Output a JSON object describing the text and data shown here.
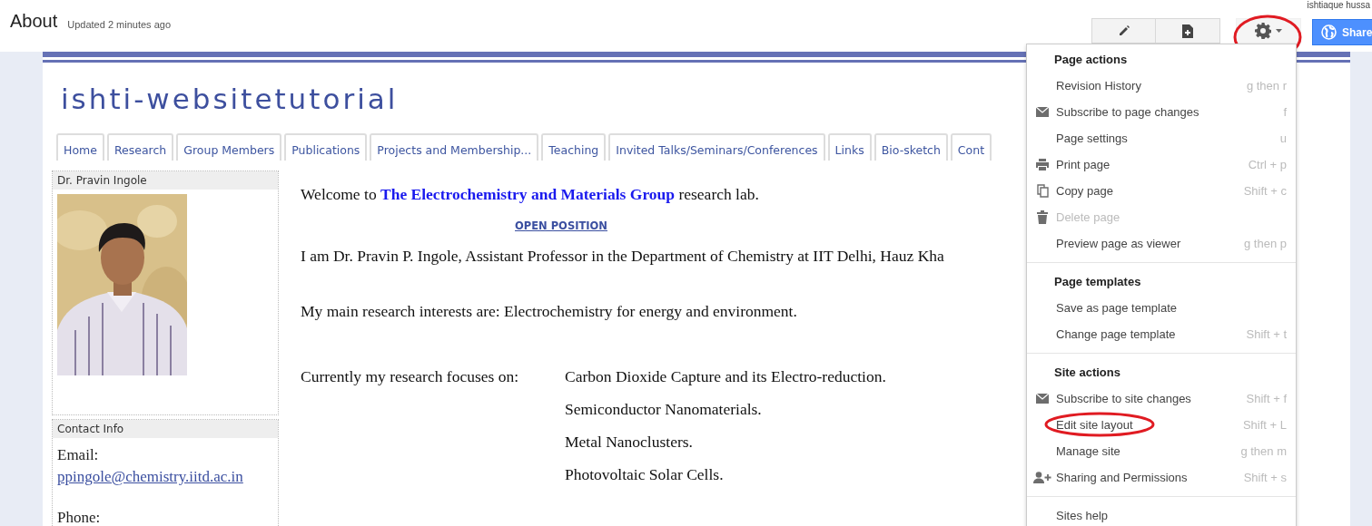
{
  "header": {
    "title": "About",
    "updated": "Updated 2 minutes ago",
    "user": "ishtiaque hussa",
    "share": "Share",
    "settings_circled": true
  },
  "site": {
    "title": "ishti-websitetutorial",
    "tabs": [
      {
        "label": "Home",
        "selected": false
      },
      {
        "label": "Research",
        "selected": false
      },
      {
        "label": "Group Members",
        "selected": false
      },
      {
        "label": "Publications",
        "selected": false
      },
      {
        "label": "Projects and Membership...",
        "selected": false
      },
      {
        "label": "Teaching",
        "selected": false
      },
      {
        "label": "Invited Talks/Seminars/Conferences",
        "selected": false
      },
      {
        "label": "Links",
        "selected": false
      },
      {
        "label": "Bio-sketch",
        "selected": false
      },
      {
        "label": "Cont",
        "selected": false
      }
    ],
    "sidebar": [
      {
        "title": "Dr. Pravin Ingole",
        "kind": "picture"
      },
      {
        "title": "Contact Info",
        "kind": "contact",
        "lines": [
          "Email:"
        ],
        "email": "ppingole@chemistry.iitd.ac.in",
        "after": [
          "Phone:"
        ]
      }
    ],
    "content": {
      "welcome": "Welcome to **The Electrochemistry and Materials Group** research lab.",
      "link": "OPEN POSITION",
      "intro": "I am Dr. Pravin P. Ingole, Assistant Professor in the Department of Chemistry at IIT Delhi, Hauz Kha",
      "interests": "My main research interests are: Electrochemistry for energy and environment.",
      "focus_label": "Currently my research focuses on:",
      "focus": [
        "Carbon Dioxide Capture and its Electro-reduction.",
        "Semiconductor Nanomaterials.",
        "Metal Nanoclusters.",
        "Photovoltaic Solar Cells."
      ]
    }
  },
  "menu": {
    "sections": [
      {
        "title": "Page actions",
        "items": [
          {
            "label": "Revision History",
            "shortcut": "g then r",
            "kind": "none",
            "disabled": false,
            "circled": false
          },
          {
            "label": "Subscribe to page changes",
            "shortcut": "f",
            "kind": "mail",
            "disabled": false,
            "circled": false
          },
          {
            "label": "Page settings",
            "shortcut": "u",
            "kind": "none",
            "disabled": false,
            "circled": false
          },
          {
            "label": "Print page",
            "shortcut": "Ctrl + p",
            "kind": "print",
            "disabled": false,
            "circled": false
          },
          {
            "label": "Copy page",
            "shortcut": "Shift + c",
            "kind": "copy",
            "disabled": false,
            "circled": false
          },
          {
            "label": "Delete page",
            "kind": "trash",
            "disabled": true,
            "circled": false
          },
          {
            "label": "Preview page as viewer",
            "shortcut": "g then p",
            "kind": "none",
            "disabled": false,
            "circled": false
          }
        ]
      },
      {
        "title": "Page templates",
        "items": [
          {
            "label": "Save as page template",
            "kind": "none",
            "disabled": false,
            "circled": false
          },
          {
            "label": "Change page template",
            "shortcut": "Shift + t",
            "kind": "none",
            "disabled": false,
            "circled": false
          }
        ]
      },
      {
        "title": "Site actions",
        "items": [
          {
            "label": "Subscribe to site changes",
            "shortcut": "Shift + f",
            "kind": "mail",
            "disabled": false,
            "circled": false
          },
          {
            "label": "Edit site layout",
            "shortcut": "Shift + L",
            "kind": "none",
            "disabled": false,
            "circled": true
          },
          {
            "label": "Manage site",
            "shortcut": "g then m",
            "kind": "none",
            "disabled": false,
            "circled": false
          },
          {
            "label": "Sharing and Permissions",
            "shortcut": "Shift + s",
            "kind": "person-add",
            "disabled": false,
            "circled": false
          }
        ]
      },
      {
        "items": [
          {
            "label": "Sites help",
            "kind": "none",
            "disabled": false,
            "circled": false
          }
        ]
      }
    ]
  }
}
